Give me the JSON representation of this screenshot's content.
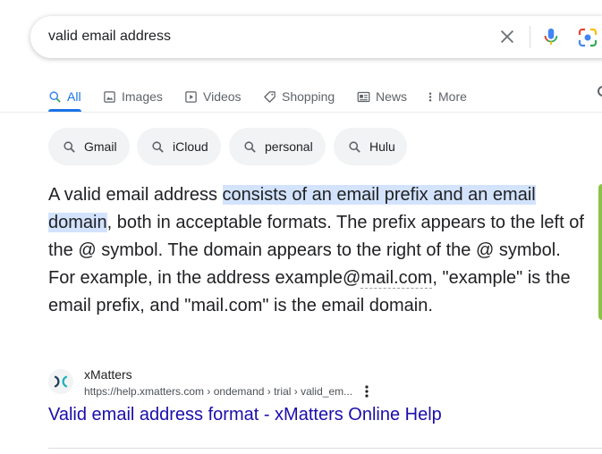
{
  "search": {
    "query": "valid email address"
  },
  "tabs": [
    {
      "label": "All",
      "icon": "search-icon",
      "active": true
    },
    {
      "label": "Images",
      "icon": "image-icon"
    },
    {
      "label": "Videos",
      "icon": "play-icon"
    },
    {
      "label": "Shopping",
      "icon": "tag-icon"
    },
    {
      "label": "News",
      "icon": "newspaper-icon"
    },
    {
      "label": "More",
      "icon": "more-vert-icon"
    }
  ],
  "chips": [
    {
      "label": "Gmail"
    },
    {
      "label": "iCloud"
    },
    {
      "label": "personal"
    },
    {
      "label": "Hulu"
    }
  ],
  "snippet": {
    "part1": "A valid email address ",
    "highlight": "consists of an email prefix and an email domain",
    "part2": ", both in acceptable formats. The prefix appears to the left of the @ symbol. The domain appears to the right of the @ symbol. For example, in the address example@",
    "link_term": "mail.com",
    "part3": ", \"example\" is the email prefix, and \"mail.com\" is the email domain."
  },
  "result": {
    "site_name": "xMatters",
    "url": "https://help.xmatters.com › ondemand › trial › valid_em...",
    "title": "Valid email address format - xMatters Online Help"
  },
  "colors": {
    "accent": "#1a73e8",
    "link": "#1a0dab",
    "highlight": "#d3e3fd",
    "chip_bg": "#f1f3f4"
  }
}
